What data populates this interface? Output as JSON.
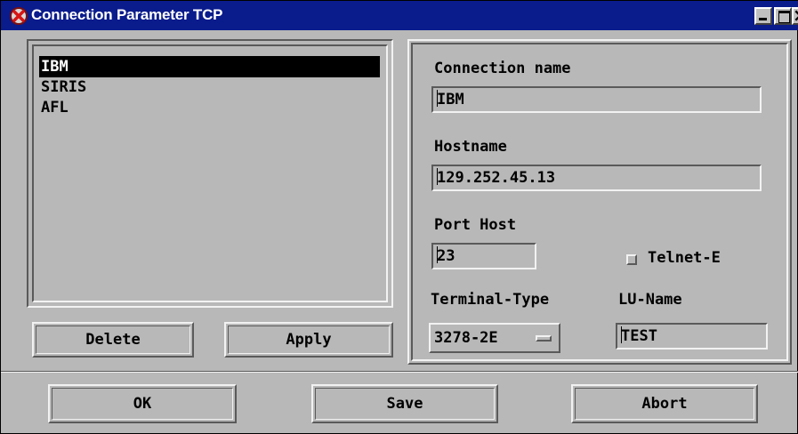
{
  "window": {
    "title": "Connection Parameter TCP",
    "icon": "x-circle-icon"
  },
  "connections": {
    "items": [
      "IBM",
      "SIRIS",
      "AFL"
    ],
    "selected_index": 0
  },
  "buttons": {
    "delete": "Delete",
    "apply": "Apply",
    "ok": "OK",
    "save": "Save",
    "abort": "Abort"
  },
  "form": {
    "connection_name_label": "Connection name",
    "connection_name_value": "IBM",
    "hostname_label": "Hostname",
    "hostname_value": "129.252.45.13",
    "port_host_label": "Port Host",
    "port_host_value": "23",
    "telnet_label": "Telnet-E",
    "telnet_checked": false,
    "terminal_type_label": "Terminal-Type",
    "terminal_type_value": "3278-2E",
    "lu_name_label": "LU-Name",
    "lu_name_value": "TEST"
  },
  "colors": {
    "titlebar": "#0a1b8c",
    "face": "#b8b8b8",
    "selection": "#000000"
  }
}
